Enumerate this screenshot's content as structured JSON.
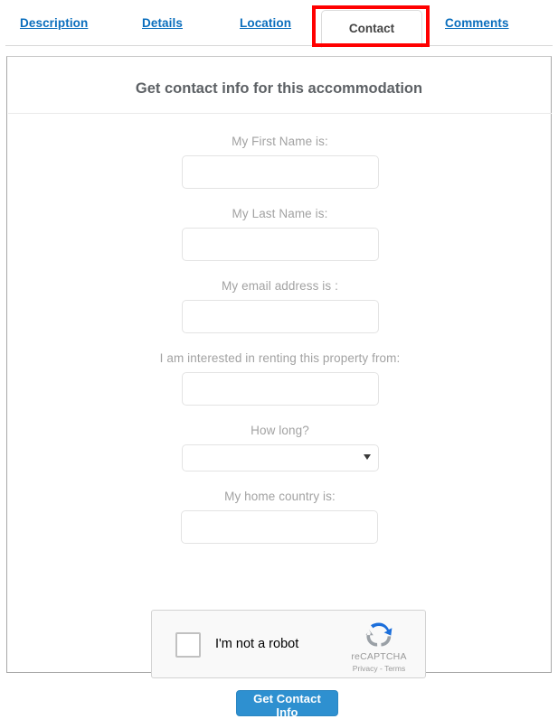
{
  "tabs": [
    {
      "label": "Description",
      "active": false
    },
    {
      "label": "Details",
      "active": false
    },
    {
      "label": "Location",
      "active": false
    },
    {
      "label": "Contact",
      "active": true
    },
    {
      "label": "Comments",
      "active": false
    }
  ],
  "panel": {
    "heading": "Get contact info for this accommodation"
  },
  "form": {
    "fields": [
      {
        "label": "My First Name is:",
        "value": "",
        "type": "text"
      },
      {
        "label": "My Last Name is:",
        "value": "",
        "type": "text"
      },
      {
        "label": "My email address is :",
        "value": "",
        "type": "text"
      },
      {
        "label": "I am interested in renting this property from:",
        "value": "",
        "type": "text"
      },
      {
        "label": "How long?",
        "value": "",
        "type": "select"
      },
      {
        "label": "My home country is:",
        "value": "",
        "type": "text"
      }
    ]
  },
  "recaptcha": {
    "checkbox_label": "I'm not a robot",
    "brand": "reCAPTCHA",
    "legal": "Privacy - Terms",
    "checked": false
  },
  "submit": {
    "label": "Get Contact Info"
  },
  "colors": {
    "tab_link": "#0a6ebd",
    "heading": "#5d6165",
    "label": "#a2a2a2",
    "button": "#2e90d0",
    "annotation": "#ff0000",
    "recaptcha_blue": "#1c6fdb",
    "recaptcha_gray": "#9aa0a6"
  }
}
